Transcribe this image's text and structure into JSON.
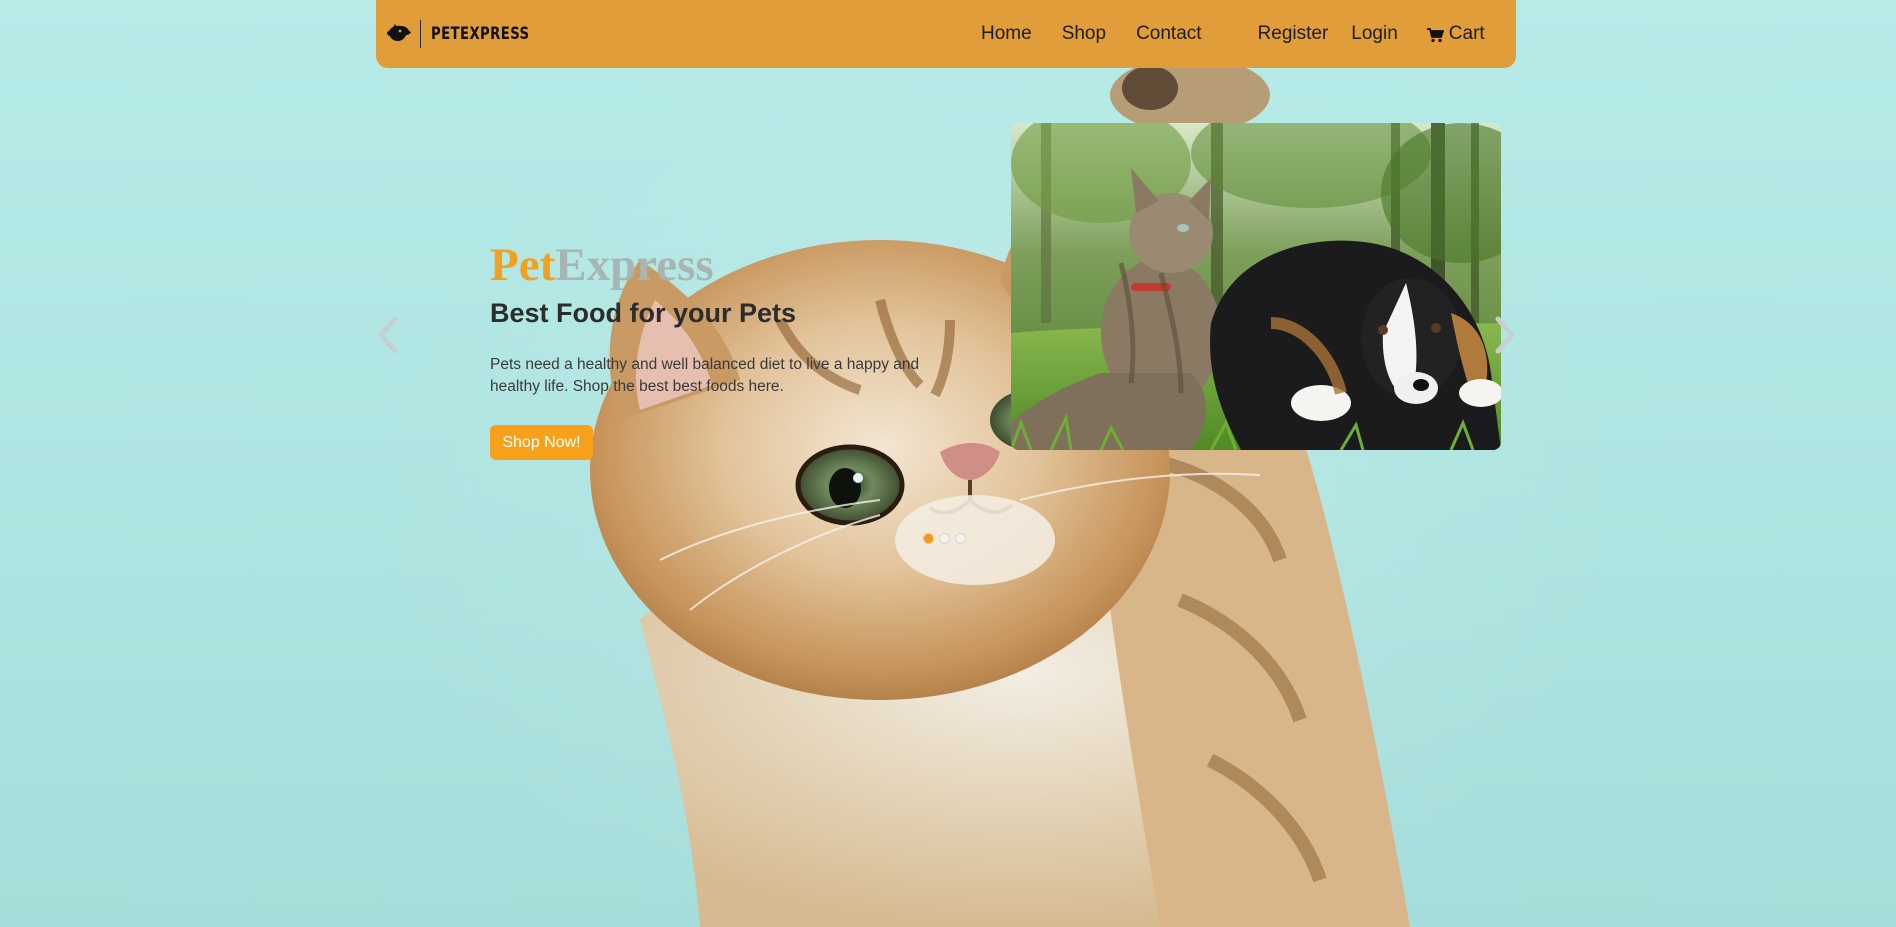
{
  "navbar": {
    "brand_name": "PETEXPRESS",
    "brand_icon": "dog-head-icon",
    "links": {
      "home": "Home",
      "shop": "Shop",
      "contact": "Contact",
      "register": "Register",
      "login": "Login",
      "cart": "Cart"
    },
    "cart_icon": "shopping-cart-icon",
    "color": "#e09d39"
  },
  "hero": {
    "title_part1": "Pet",
    "title_part2": "Express",
    "subtitle": "Best Food for your Pets",
    "description": "Pets need a healthy and well balanced diet to live a happy and healthy life. Shop the best best foods here.",
    "cta_label": "Shop Now!",
    "accent_color": "#f7a11b",
    "secondary_title_color": "#a8b5b4"
  },
  "carousel": {
    "slide_count": 3,
    "active_slide": 1,
    "prev_icon": "chevron-left-icon",
    "next_icon": "chevron-right-icon"
  },
  "background": {
    "color": "#b2e6e3"
  }
}
